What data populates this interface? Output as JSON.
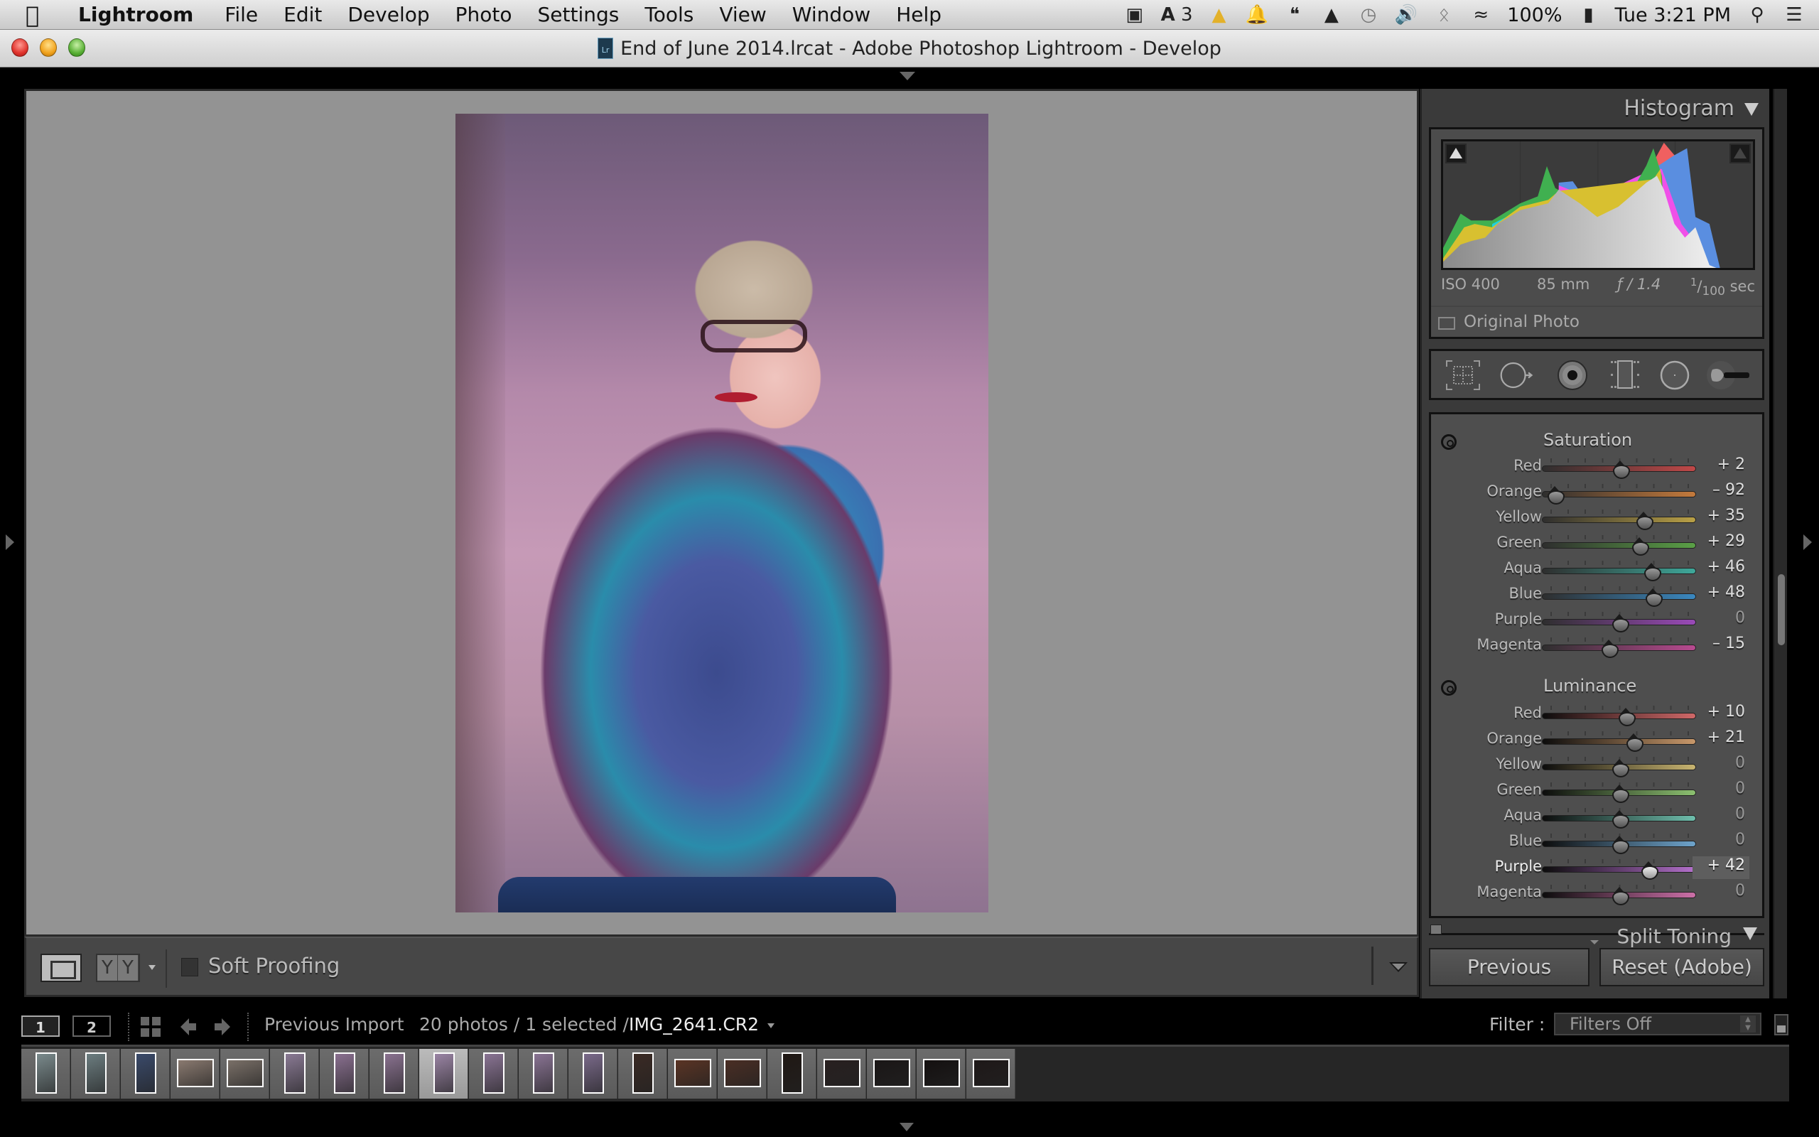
{
  "menubar": {
    "app_name": "Lightroom",
    "items": [
      "File",
      "Edit",
      "Develop",
      "Photo",
      "Settings",
      "Tools",
      "View",
      "Window",
      "Help"
    ],
    "status": {
      "adobe_badge": "3",
      "battery": "100%",
      "clock": "Tue 3:21 PM"
    },
    "icons": [
      "display-icon",
      "adobe-icon",
      "cone-icon",
      "notification-bell-icon",
      "hangouts-icon",
      "airplay-icon",
      "time-machine-icon",
      "volume-icon",
      "bluetooth-icon",
      "wifi-icon",
      "battery-icon",
      "spotlight-search-icon",
      "notification-center-icon"
    ]
  },
  "window": {
    "title": "End of June 2014.lrcat - Adobe Photoshop Lightroom - Develop"
  },
  "toolbar": {
    "soft_proofing_label": "Soft Proofing",
    "soft_proofing_checked": false,
    "before_after_label_left": "Y",
    "before_after_label_right": "Y"
  },
  "histogram": {
    "title": "Histogram",
    "exif": {
      "iso": "ISO 400",
      "focal_length": "85 mm",
      "aperture": "ƒ / 1.4",
      "shutter_num": "1",
      "shutter_den": "100",
      "shutter_unit": "sec"
    },
    "original_photo_label": "Original Photo",
    "original_photo_checked": false
  },
  "tools": [
    "crop-overlay-icon",
    "spot-removal-icon",
    "red-eye-icon",
    "graduated-filter-icon",
    "radial-filter-icon",
    "adjustment-brush-icon"
  ],
  "hsl": {
    "saturation": {
      "title": "Saturation",
      "rows": [
        {
          "label": "Red",
          "value": "+ 2",
          "num": 2,
          "color": "#c04848"
        },
        {
          "label": "Orange",
          "value": "– 92",
          "num": -92,
          "color": "#c47a3c"
        },
        {
          "label": "Yellow",
          "value": "+ 35",
          "num": 35,
          "color": "#b9a046"
        },
        {
          "label": "Green",
          "value": "+ 29",
          "num": 29,
          "color": "#5aa046"
        },
        {
          "label": "Aqua",
          "value": "+ 46",
          "num": 46,
          "color": "#3ea89a"
        },
        {
          "label": "Blue",
          "value": "+ 48",
          "num": 48,
          "color": "#3a88c0"
        },
        {
          "label": "Purple",
          "value": "0",
          "num": 0,
          "color": "#9a4ab8"
        },
        {
          "label": "Magenta",
          "value": "– 15",
          "num": -15,
          "color": "#b84a90"
        }
      ]
    },
    "luminance": {
      "title": "Luminance",
      "rows": [
        {
          "label": "Red",
          "value": "+ 10",
          "num": 10,
          "color": "#d06868"
        },
        {
          "label": "Orange",
          "value": "+ 21",
          "num": 21,
          "color": "#c8986a"
        },
        {
          "label": "Yellow",
          "value": "0",
          "num": 0,
          "color": "#c8b470"
        },
        {
          "label": "Green",
          "value": "0",
          "num": 0,
          "color": "#8cc070"
        },
        {
          "label": "Aqua",
          "value": "0",
          "num": 0,
          "color": "#6ebeac"
        },
        {
          "label": "Blue",
          "value": "0",
          "num": 0,
          "color": "#6ea4cc"
        },
        {
          "label": "Purple",
          "value": "+ 42",
          "num": 42,
          "color": "#b470cc",
          "active": true
        },
        {
          "label": "Magenta",
          "value": "0",
          "num": 0,
          "color": "#cc70a8"
        }
      ]
    },
    "next_panel_title": "Split Toning"
  },
  "buttons": {
    "previous": "Previous",
    "reset": "Reset (Adobe)"
  },
  "filmstrip_bar": {
    "screen1": "1",
    "screen2": "2",
    "source": "Previous Import",
    "count": "20 photos / 1 selected /",
    "filename": "IMG_2641.CR2",
    "filter_label": "Filter :",
    "filter_value": "Filters Off"
  },
  "filmstrip": {
    "total": 20,
    "selected_index": 8,
    "thumbs": [
      {
        "orientation": "portrait",
        "tone": "#7a8a8c"
      },
      {
        "orientation": "portrait",
        "tone": "#6c7d80"
      },
      {
        "orientation": "portrait",
        "tone": "#3a4a6a"
      },
      {
        "orientation": "landscape",
        "tone": "#8a7a70"
      },
      {
        "orientation": "landscape",
        "tone": "#7a7068"
      },
      {
        "orientation": "portrait",
        "tone": "#8a7a94"
      },
      {
        "orientation": "portrait",
        "tone": "#8a7090"
      },
      {
        "orientation": "portrait",
        "tone": "#8a7290"
      },
      {
        "orientation": "portrait",
        "tone": "#9a84a4"
      },
      {
        "orientation": "portrait",
        "tone": "#8a7494"
      },
      {
        "orientation": "portrait",
        "tone": "#8a7494"
      },
      {
        "orientation": "portrait",
        "tone": "#7a6a8a"
      },
      {
        "orientation": "portrait",
        "tone": "#3a2a24"
      },
      {
        "orientation": "landscape",
        "tone": "#5a3424"
      },
      {
        "orientation": "landscape",
        "tone": "#4a2e24"
      },
      {
        "orientation": "portrait",
        "tone": "#201814"
      },
      {
        "orientation": "landscape",
        "tone": "#282020"
      },
      {
        "orientation": "landscape",
        "tone": "#1a1616"
      },
      {
        "orientation": "landscape",
        "tone": "#141010"
      },
      {
        "orientation": "landscape",
        "tone": "#1e1818"
      }
    ]
  }
}
